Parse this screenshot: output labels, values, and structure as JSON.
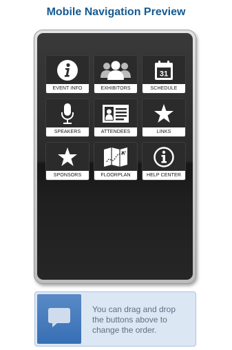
{
  "page": {
    "title": "Mobile Navigation Preview"
  },
  "tiles": [
    {
      "label": "EVENT INFO",
      "icon": "info-circle-icon"
    },
    {
      "label": "EXHIBITORS",
      "icon": "people-group-icon"
    },
    {
      "label": "SCHEDULE",
      "icon": "calendar-icon",
      "icon_text": "31"
    },
    {
      "label": "SPEAKERS",
      "icon": "microphone-icon"
    },
    {
      "label": "ATTENDEES",
      "icon": "id-card-icon"
    },
    {
      "label": "LINKS",
      "icon": "star-icon"
    },
    {
      "label": "SPONSORS",
      "icon": "star-icon"
    },
    {
      "label": "FLOORPLAN",
      "icon": "map-icon"
    },
    {
      "label": "HELP CENTER",
      "icon": "info-outline-icon"
    }
  ],
  "info": {
    "icon": "speech-bubble-icon",
    "text": "You can drag and drop the buttons above to change the order."
  },
  "colors": {
    "title": "#15598f",
    "info_bg": "#dce7f4",
    "info_icon_bg": "#376fb5",
    "tile_bg": "#2b2b2b"
  }
}
